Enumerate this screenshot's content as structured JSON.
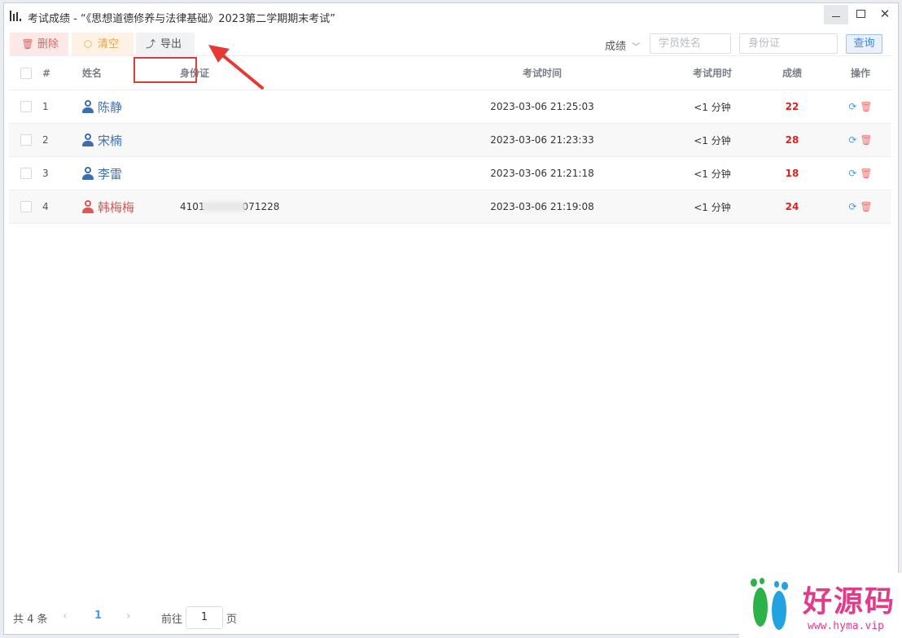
{
  "window": {
    "title": "考试成绩 - “《思想道德修养与法律基础》2023第二学期期末考试”",
    "minimize_label": "",
    "close_symbol": "✕"
  },
  "toolbar": {
    "delete_label": "删除",
    "clear_label": "清空",
    "export_label": "导出",
    "sort_label": "成绩",
    "sort_chevron": "﹀",
    "name_placeholder": "学员姓名",
    "id_placeholder": "身份证",
    "query_label": "查询"
  },
  "table": {
    "headers": {
      "num": "#",
      "name": "姓名",
      "id": "身份证",
      "time": "考试时间",
      "duration": "考试用时",
      "score": "成绩",
      "ops": "操作"
    },
    "rows": [
      {
        "num": "1",
        "name": "陈静",
        "gender": "male",
        "id_prefix": "",
        "id_suffix": "",
        "time": "2023-03-06 21:25:03",
        "duration": "<1 分钟",
        "score": "22"
      },
      {
        "num": "2",
        "name": "宋楠",
        "gender": "male",
        "id_prefix": "",
        "id_suffix": "",
        "time": "2023-03-06 21:23:33",
        "duration": "<1 分钟",
        "score": "28"
      },
      {
        "num": "3",
        "name": "李雷",
        "gender": "male",
        "id_prefix": "",
        "id_suffix": "",
        "time": "2023-03-06 21:21:18",
        "duration": "<1 分钟",
        "score": "18"
      },
      {
        "num": "4",
        "name": "韩梅梅",
        "gender": "female",
        "id_prefix": "4101",
        "id_suffix": "071228",
        "time": "2023-03-06 21:19:08",
        "duration": "<1 分钟",
        "score": "24"
      }
    ]
  },
  "pagination": {
    "total_label": "共 4 条",
    "current_page": "1",
    "goto_label": "前往",
    "goto_value": "1",
    "page_unit": "页"
  },
  "watermark": {
    "text": "好源码",
    "url": "www.hyma.vip"
  },
  "colors": {
    "score_red": "#e02020",
    "name_blue": "#3b73b9",
    "name_red": "#e05555",
    "annotation_red": "#e53935",
    "watermark_pink": "#e03c8a"
  }
}
